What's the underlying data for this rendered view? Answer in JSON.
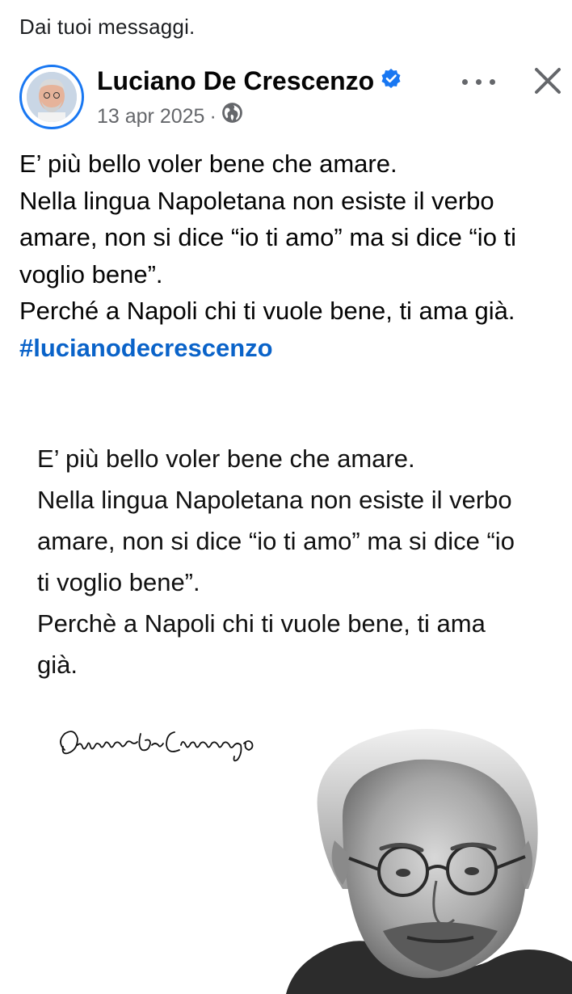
{
  "section_label": "Dai tuoi messaggi.",
  "post": {
    "author": "Luciano De Crescenzo",
    "verified": true,
    "date": "13 apr 2025",
    "separator": "·",
    "visibility_icon": "globe-icon",
    "text_lines": [
      "E’ più bello voler bene che amare.",
      "Nella lingua Napoletana non esiste il verbo amare, non si dice “io ti amo” ma si dice “io ti voglio bene”.",
      "Perché a Napoli chi ti vuole bene, ti ama già."
    ],
    "hashtag": "#lucianodecrescenzo"
  },
  "image": {
    "quote_lines": [
      "E’ più bello voler bene che amare.",
      "Nella lingua Napoletana non esiste il verbo amare, non si dice “io ti amo” ma si dice “io ti voglio bene”.",
      "Perchè a Napoli chi ti vuole bene, ti ama già."
    ],
    "signature_text": "Luciano De Crescenzo"
  },
  "icons": {
    "more": "more-options-icon",
    "close": "close-icon",
    "verified": "verified-badge-icon",
    "globe": "globe-icon"
  },
  "colors": {
    "verified_blue": "#1877f2",
    "hashtag_blue": "#0a63c9",
    "meta_gray": "#65676b"
  }
}
